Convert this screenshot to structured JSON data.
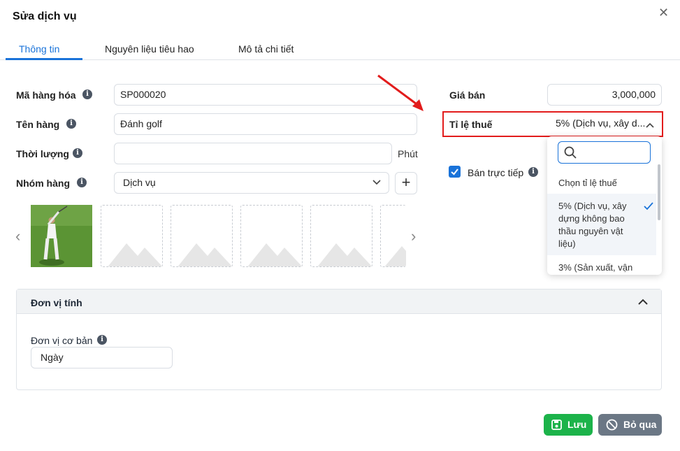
{
  "dialog": {
    "title": "Sửa dịch vụ"
  },
  "tabs": [
    {
      "label": "Thông tin",
      "active": true
    },
    {
      "label": "Nguyên liệu tiêu hao",
      "active": false
    },
    {
      "label": "Mô tả chi tiết",
      "active": false
    }
  ],
  "form": {
    "code": {
      "label": "Mã hàng hóa",
      "value": "SP000020"
    },
    "name": {
      "label": "Tên hàng",
      "value": "Đánh golf"
    },
    "duration": {
      "label": "Thời lượng",
      "value": "",
      "unit": "Phút"
    },
    "group": {
      "label": "Nhóm hàng",
      "value": "Dịch vụ"
    },
    "price": {
      "label": "Giá bán",
      "value": "3,000,000"
    },
    "tax": {
      "label": "Tỉ lệ thuế",
      "value": "5% (Dịch vụ, xây d..."
    },
    "direct_sale": {
      "label": "Bán trực tiếp",
      "checked": true
    }
  },
  "tax_dropdown": {
    "search_placeholder": "",
    "options": [
      {
        "label": "Chọn tỉ lệ thuế",
        "selected": false
      },
      {
        "label": "5% (Dịch vụ, xây dựng không bao thầu nguyên vật liệu)",
        "selected": true
      },
      {
        "label": "3% (Sản xuất, vận",
        "selected": false
      }
    ]
  },
  "unit_section": {
    "title": "Đơn vị tính",
    "base_unit_label": "Đơn vị cơ bản",
    "base_unit_value": "Ngày"
  },
  "buttons": {
    "save": "Lưu",
    "cancel": "Bỏ qua"
  },
  "colors": {
    "primary": "#1a73d9",
    "save": "#1cb34a",
    "cancel": "#6b7785",
    "highlight": "#e21c1c"
  }
}
